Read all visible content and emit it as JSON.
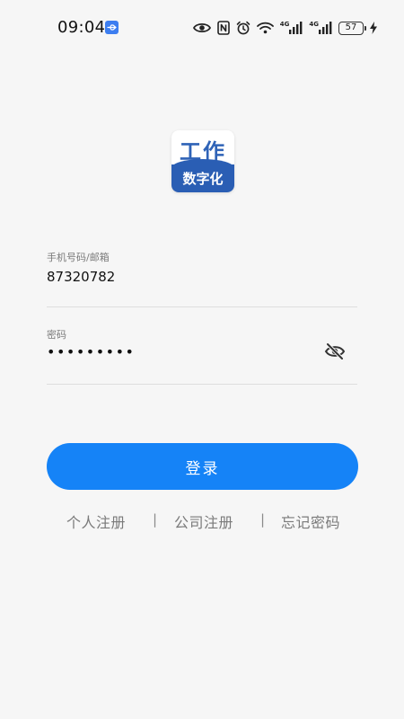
{
  "status_bar": {
    "time": "09:04",
    "net_label_1": "4G",
    "net_label_2": "4G",
    "battery_level": "57",
    "icons": [
      "usb-icon",
      "eye-comfort-icon",
      "nfc-icon",
      "alarm-icon",
      "wifi-icon",
      "signal-icon",
      "signal-icon",
      "battery-icon",
      "charging-icon"
    ]
  },
  "logo": {
    "top_text": "工作",
    "bottom_text": "数字化",
    "colors": {
      "primary": "#2a5eb4",
      "text": "#2f63b7"
    }
  },
  "form": {
    "account": {
      "label": "手机号码/邮箱",
      "value": "87320782"
    },
    "password": {
      "label": "密码",
      "value": "•••••••••"
    },
    "toggle_icon": "eye-hidden-icon"
  },
  "login_button": {
    "label": "登录",
    "color": "#1583f7"
  },
  "links": {
    "personal_register": "个人注册",
    "separator_1": "|",
    "company_register": "公司注册",
    "separator_2": "|",
    "forgot_password": "忘记密码"
  }
}
